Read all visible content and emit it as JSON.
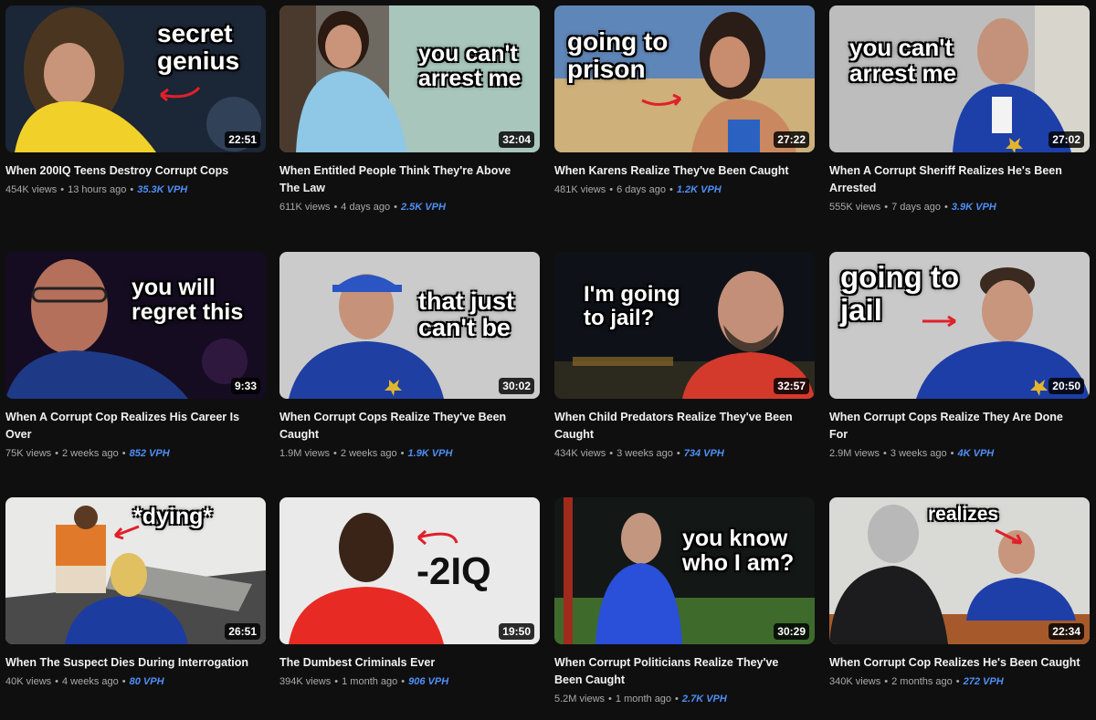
{
  "videos": [
    {
      "title": "When 200IQ Teens Destroy Corrupt Cops",
      "views": "454K views",
      "age": "13 hours ago",
      "vph": "35.3K VPH",
      "duration": "22:51",
      "overlay": "secret\ngenius"
    },
    {
      "title": "When Entitled People Think They're Above The Law",
      "views": "611K views",
      "age": "4 days ago",
      "vph": "2.5K VPH",
      "duration": "32:04",
      "overlay": "you can't\narrest me"
    },
    {
      "title": "When Karens Realize They've Been Caught",
      "views": "481K views",
      "age": "6 days ago",
      "vph": "1.2K VPH",
      "duration": "27:22",
      "overlay": "going to\nprison"
    },
    {
      "title": "When A Corrupt Sheriff Realizes He's Been Arrested",
      "views": "555K views",
      "age": "7 days ago",
      "vph": "3.9K VPH",
      "duration": "27:02",
      "overlay": "you can't\narrest me"
    },
    {
      "title": "When A Corrupt Cop Realizes His Career Is Over",
      "views": "75K views",
      "age": "2 weeks ago",
      "vph": "852 VPH",
      "duration": "9:33",
      "overlay": "you will\nregret this"
    },
    {
      "title": "When Corrupt Cops Realize They've Been Caught",
      "views": "1.9M views",
      "age": "2 weeks ago",
      "vph": "1.9K VPH",
      "duration": "30:02",
      "overlay": "that just\ncan't be"
    },
    {
      "title": "When Child Predators Realize They've Been Caught",
      "views": "434K views",
      "age": "3 weeks ago",
      "vph": "734 VPH",
      "duration": "32:57",
      "overlay": "I'm going\nto jail?"
    },
    {
      "title": "When Corrupt Cops Realize They Are Done For",
      "views": "2.9M views",
      "age": "3 weeks ago",
      "vph": "4K VPH",
      "duration": "20:50",
      "overlay": "going to\njail"
    },
    {
      "title": "When The Suspect Dies During Interrogation",
      "views": "40K views",
      "age": "4 weeks ago",
      "vph": "80 VPH",
      "duration": "26:51",
      "overlay": "*dying*"
    },
    {
      "title": "The Dumbest Criminals Ever",
      "views": "394K views",
      "age": "1 month ago",
      "vph": "906 VPH",
      "duration": "19:50",
      "overlay": "-2IQ"
    },
    {
      "title": "When Corrupt Politicians Realize They've Been Caught",
      "views": "5.2M views",
      "age": "1 month ago",
      "vph": "2.7K VPH",
      "duration": "30:29",
      "overlay": "you know\nwho I am?"
    },
    {
      "title": "When Corrupt Cop Realizes He's Been Caught",
      "views": "340K views",
      "age": "2 months ago",
      "vph": "272 VPH",
      "duration": "22:34",
      "overlay": "realizes"
    }
  ],
  "colors": {
    "background": "#0f0f0f",
    "title": "#f1f1f1",
    "meta": "#aaaaaa",
    "vph": "#4f8ff7",
    "arrow": "#e0202a"
  }
}
